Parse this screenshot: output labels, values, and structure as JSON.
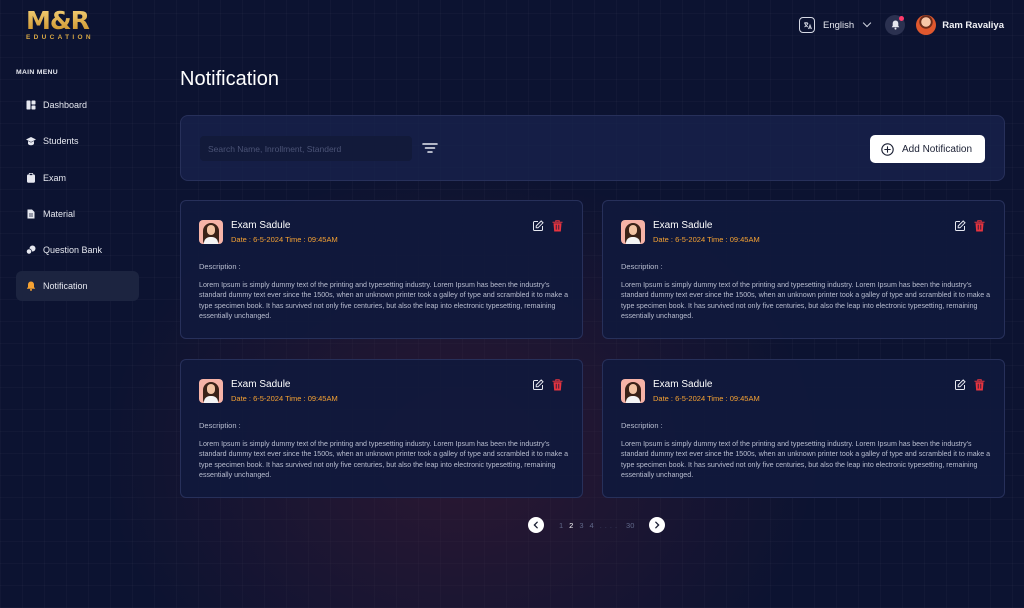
{
  "brand": {
    "logo_main": "M&R",
    "logo_sub": "EDUCATION"
  },
  "header": {
    "language": "English",
    "user_name": "Ram Ravaliya"
  },
  "sidebar": {
    "title": "MAIN MENU",
    "items": [
      {
        "label": "Dashboard",
        "icon": "dashboard-icon",
        "active": false
      },
      {
        "label": "Students",
        "icon": "graduation-cap-icon",
        "active": false
      },
      {
        "label": "Exam",
        "icon": "clipboard-icon",
        "active": false
      },
      {
        "label": "Material",
        "icon": "document-icon",
        "active": false
      },
      {
        "label": "Question Bank",
        "icon": "question-bank-icon",
        "active": false
      },
      {
        "label": "Notification",
        "icon": "bell-icon",
        "active": true
      }
    ]
  },
  "main": {
    "title": "Notification",
    "search_placeholder": "Search Name, Inrollment, Standerd",
    "add_button": "Add Notification",
    "cards": [
      {
        "title": "Exam Sadule",
        "date": "Date : 6-5-2024 Time : 09:45AM",
        "description_label": "Description :",
        "description": "Lorem Ipsum is simply dummy text of the printing and typesetting industry. Lorem Ipsum has been the industry's standard dummy text ever since the 1500s, when an unknown printer took a galley of type and scrambled it to make a type specimen book. It has survived not only five centuries, but also the leap into electronic typesetting, remaining essentially unchanged."
      },
      {
        "title": "Exam Sadule",
        "date": "Date : 6-5-2024 Time : 09:45AM",
        "description_label": "Description :",
        "description": "Lorem Ipsum is simply dummy text of the printing and typesetting industry. Lorem Ipsum has been the industry's standard dummy text ever since the 1500s, when an unknown printer took a galley of type and scrambled it to make a type specimen book. It has survived not only five centuries, but also the leap into electronic typesetting, remaining essentially unchanged."
      },
      {
        "title": "Exam Sadule",
        "date": "Date : 6-5-2024 Time : 09:45AM",
        "description_label": "Description :",
        "description": "Lorem Ipsum is simply dummy text of the printing and typesetting industry. Lorem Ipsum has been the industry's standard dummy text ever since the 1500s, when an unknown printer took a galley of type and scrambled it to make a type specimen book. It has survived not only five centuries, but also the leap into electronic typesetting, remaining essentially unchanged."
      },
      {
        "title": "Exam Sadule",
        "date": "Date : 6-5-2024 Time : 09:45AM",
        "description_label": "Description :",
        "description": "Lorem Ipsum is simply dummy text of the printing and typesetting industry. Lorem Ipsum has been the industry's standard dummy text ever since the 1500s, when an unknown printer took a galley of type and scrambled it to make a type specimen book. It has survived not only five centuries, but also the leap into electronic typesetting, remaining essentially unchanged."
      }
    ],
    "pagination": {
      "pages": [
        "1",
        "2",
        "3",
        "4"
      ],
      "current": "2",
      "ellipsis": "....",
      "last": "30"
    }
  },
  "colors": {
    "background": "#0c1331",
    "accent_orange": "#f5a233",
    "delete_red": "#e8343f",
    "logo_gold": "#e2b24b"
  }
}
